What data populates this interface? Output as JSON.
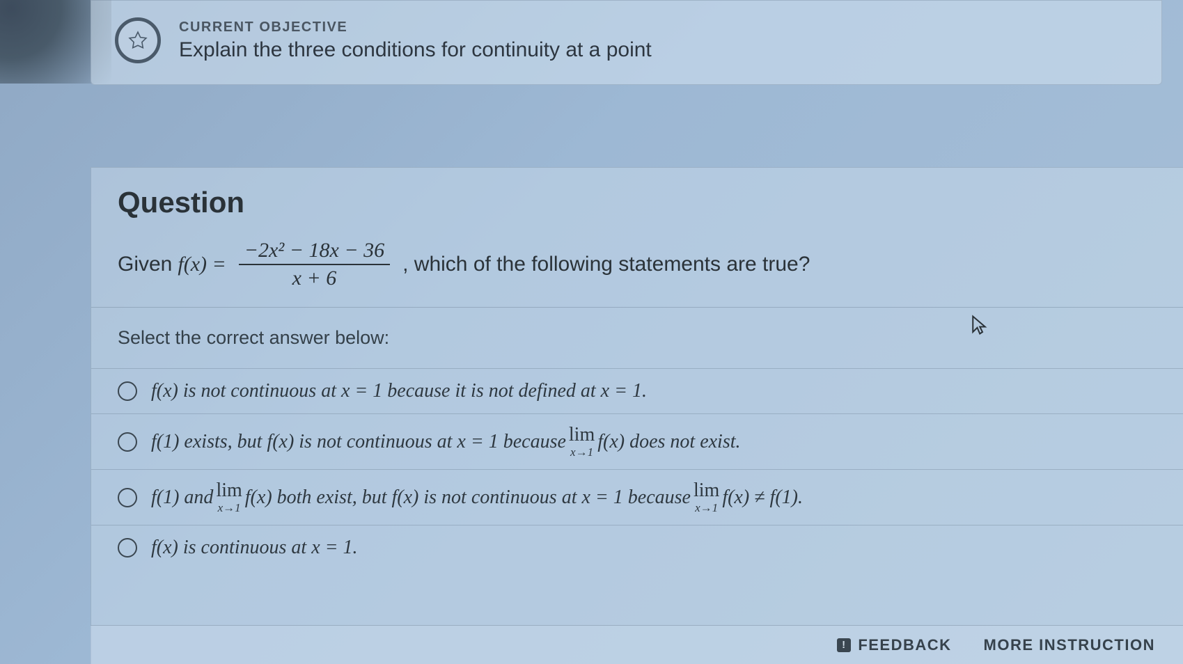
{
  "objective": {
    "label": "CURRENT OBJECTIVE",
    "description": "Explain the three conditions for continuity at a point"
  },
  "question": {
    "heading": "Question",
    "given_prefix": "Given ",
    "function_lhs": "f(x) = ",
    "numerator": "−2x² − 18x − 36",
    "denominator": "x + 6",
    "given_suffix": ", which of the following statements are true?",
    "instruction": "Select the correct answer below:"
  },
  "options": [
    {
      "pre": "f(x) is not continuous at x = 1 because it is not defined at x = 1."
    },
    {
      "pre": "f(1) exists, but f(x) is not continuous at x = 1 because ",
      "lim_top": "lim",
      "lim_bot": "x→1",
      "mid": " f(x) does not exist."
    },
    {
      "pre": "f(1) and ",
      "lim_top": "lim",
      "lim_bot": "x→1",
      "mid": " f(x) both exist, but f(x) is not continuous at x = 1 because ",
      "lim2_top": "lim",
      "lim2_bot": "x→1",
      "post": " f(x) ≠ f(1)."
    },
    {
      "pre": "f(x) is continuous at x = 1."
    }
  ],
  "footer": {
    "feedback": "FEEDBACK",
    "more": "MORE INSTRUCTION"
  }
}
